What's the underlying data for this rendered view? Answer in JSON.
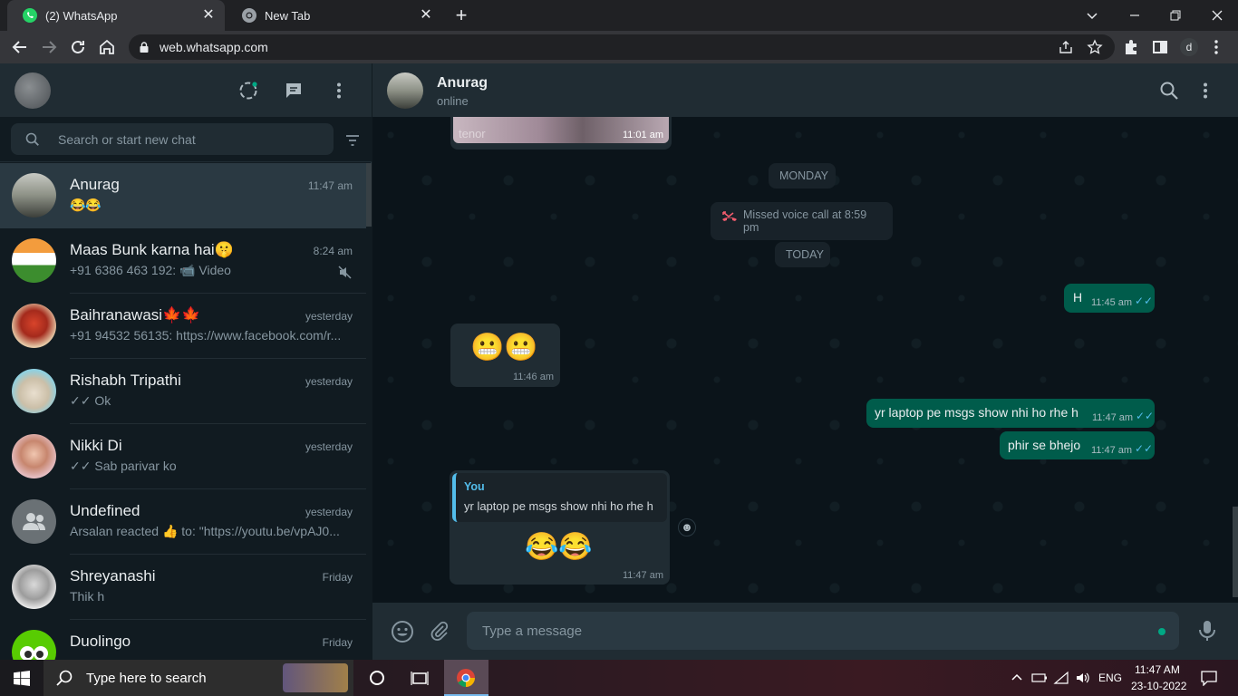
{
  "browser": {
    "tabs": [
      {
        "title": "(2) WhatsApp",
        "active": true
      },
      {
        "title": "New Tab",
        "active": false
      }
    ],
    "url": "web.whatsapp.com",
    "profile_letter": "d"
  },
  "sidebar": {
    "search_placeholder": "Search or start new chat",
    "chats": [
      {
        "name": "Anurag",
        "time": "11:47 am",
        "preview": "😂😂",
        "selected": true
      },
      {
        "name": "Maas Bunk karna hai🤫",
        "time": "8:24 am",
        "preview": "+91 6386 463 192: 📹 Video",
        "muted": true
      },
      {
        "name": "Baihranawasi🍁🍁",
        "time": "yesterday",
        "preview": "+91 94532 56135: https://www.facebook.com/r..."
      },
      {
        "name": "Rishabh Tripathi",
        "time": "yesterday",
        "preview": "✓✓ Ok"
      },
      {
        "name": "Nikki Di",
        "time": "yesterday",
        "preview": "✓✓ Sab parivar ko"
      },
      {
        "name": "Undefined",
        "time": "yesterday",
        "preview": "Arsalan reacted 👍 to: \"https://youtu.be/vpAJ0..."
      },
      {
        "name": "Shreyanashi",
        "time": "Friday",
        "preview": "Thik h"
      },
      {
        "name": "Duolingo",
        "time": "Friday",
        "preview": ""
      }
    ]
  },
  "conversation": {
    "contact_name": "Anurag",
    "contact_status": "online",
    "gif_watermark": "tenor",
    "gif_time": "11:01 am",
    "day_monday": "MONDAY",
    "missed_call": "Missed voice call at 8:59 pm",
    "day_today": "TODAY",
    "messages": [
      {
        "dir": "out",
        "text": "H",
        "time": "11:45 am"
      },
      {
        "dir": "in",
        "text": "😬😬",
        "time": "11:46 am"
      },
      {
        "dir": "out",
        "text": "yr laptop pe msgs show nhi ho rhe h",
        "time": "11:47 am"
      },
      {
        "dir": "out",
        "text": "phir se bhejo",
        "time": "11:47 am"
      },
      {
        "dir": "in",
        "reply_author": "You",
        "reply_text": "yr laptop pe msgs show nhi ho rhe h",
        "text": "😂😂",
        "time": "11:47 am"
      }
    ],
    "compose_placeholder": "Type a message"
  },
  "taskbar": {
    "search_placeholder": "Type here to search",
    "time": "11:47 AM",
    "date": "23-10-2022",
    "lang": "ENG"
  },
  "colors": {
    "accent": "#00a884",
    "outgoing_bubble": "#005c4b",
    "incoming_bubble": "#202c33",
    "read_tick": "#53bdeb"
  }
}
